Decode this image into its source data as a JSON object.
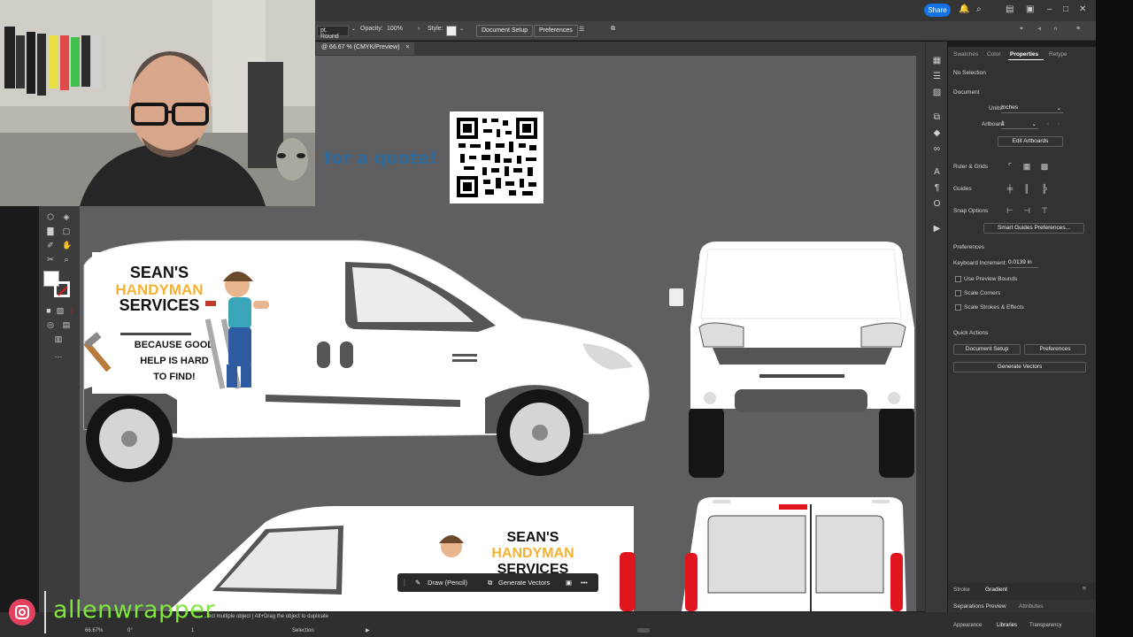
{
  "app_bar": {
    "share_label": "Share"
  },
  "control_bar": {
    "brush_value": "pt. Round",
    "opacity_label": "Opacity:",
    "opacity_value": "100%",
    "style_label": "Style:",
    "document_setup_label": "Document Setup",
    "preferences_label": "Preferences"
  },
  "doc_tab": {
    "title": "@ 66.67 % (CMYK/Preview)",
    "close": "×"
  },
  "artwork": {
    "quote_text": "for a quote!",
    "logo_line1": "SEAN'S",
    "logo_line2": "HANDYMAN",
    "logo_line3": "SERVICES",
    "tagline_line1": "BECAUSE GOOD",
    "tagline_line2": "HELP IS HARD",
    "tagline_line3": "TO FIND!",
    "colors": {
      "van_body": "#ffffff",
      "canvas": "#5f5f62",
      "accent_gold": "#f2b233",
      "tire": "#151515",
      "tail_light": "#e0151d"
    }
  },
  "context_bar": {
    "draw_label": "Draw (Pencil)",
    "generate_label": "Generate Vectors",
    "more": "•••"
  },
  "properties_panel": {
    "tabs": [
      "Swatches",
      "Color",
      "Properties",
      "Retype"
    ],
    "active_tab": "Properties",
    "no_selection": "No Selection",
    "document_heading": "Document",
    "units_label": "Units:",
    "units_value": "Inches",
    "artboard_label": "Artboard:",
    "artboard_value": "1",
    "edit_artboards": "Edit Artboards",
    "ruler_grids": "Ruler & Grids",
    "guides": "Guides",
    "snap_options": "Snap Options",
    "smart_guides_prefs": "Smart Guides Preferences...",
    "preferences_heading": "Preferences",
    "keyboard_increment_label": "Keyboard Increment:",
    "keyboard_increment_value": "0.0139 in",
    "checkboxes": [
      "Use Preview Bounds",
      "Scale Corners",
      "Scale Strokes & Effects"
    ],
    "quick_actions_heading": "Quick Actions",
    "document_setup_btn": "Document Setup",
    "preferences_btn": "Preferences",
    "generate_vectors_btn": "Generate Vectors"
  },
  "bottom_panels": {
    "row1": [
      "Stroke",
      "Gradient"
    ],
    "row2": [
      "Separations Preview",
      "Attributes"
    ],
    "row3": [
      "Appearance",
      "Libraries",
      "Transparency"
    ]
  },
  "status_bar": {
    "zoom": "66.67%",
    "rotation": "0°",
    "artboard": "1",
    "hint": "...ect multiple object  |  Alt+Drag the object to duplicate",
    "tool": "Selection"
  },
  "watermark": {
    "handle": "allenwrapper",
    "social_icon": "instagram-icon"
  }
}
